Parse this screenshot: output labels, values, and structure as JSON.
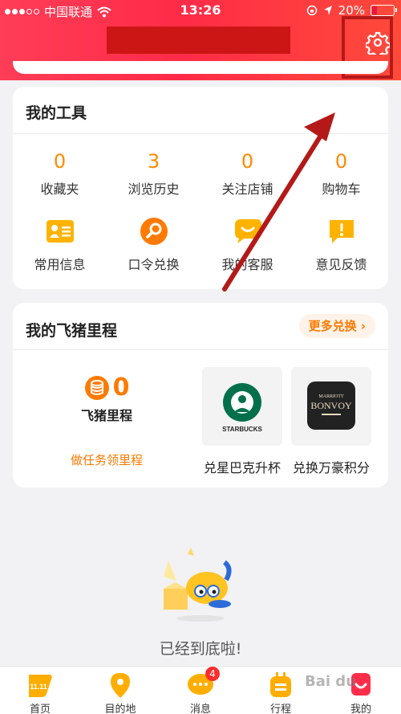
{
  "status_bar": {
    "carrier": "中国联通",
    "time": "13:26",
    "battery": "20%"
  },
  "tools": {
    "title": "我的工具",
    "stats": [
      {
        "value": "0",
        "label": "收藏夹"
      },
      {
        "value": "3",
        "label": "浏览历史"
      },
      {
        "value": "0",
        "label": "关注店铺"
      },
      {
        "value": "0",
        "label": "购物车"
      }
    ],
    "actions": [
      {
        "label": "常用信息",
        "icon": "id-card-icon"
      },
      {
        "label": "口令兑换",
        "icon": "search-icon"
      },
      {
        "label": "我的客服",
        "icon": "chat-smile-icon"
      },
      {
        "label": "意见反馈",
        "icon": "feedback-icon"
      }
    ]
  },
  "mileage": {
    "title": "我的飞猪里程",
    "more_label": "更多兑换",
    "points": "0",
    "name": "飞猪里程",
    "task_label": "做任务领里程",
    "rewards": [
      {
        "label": "兑星巴克升杯",
        "brand": "STARBUCKS"
      },
      {
        "label": "兑换万豪积分",
        "brand_top": "MARRIOTT",
        "brand": "BONVOY"
      }
    ]
  },
  "end_text": "已经到底啦!",
  "tabs": [
    {
      "label": "首页",
      "icon_text": "11.11"
    },
    {
      "label": "目的地"
    },
    {
      "label": "消息",
      "badge": "4"
    },
    {
      "label": "行程"
    },
    {
      "label": "我的"
    }
  ],
  "colors": {
    "header": "#ff3d57",
    "accent": "#ff8a00",
    "annotation": "#b41919"
  },
  "watermark": "Bai du"
}
